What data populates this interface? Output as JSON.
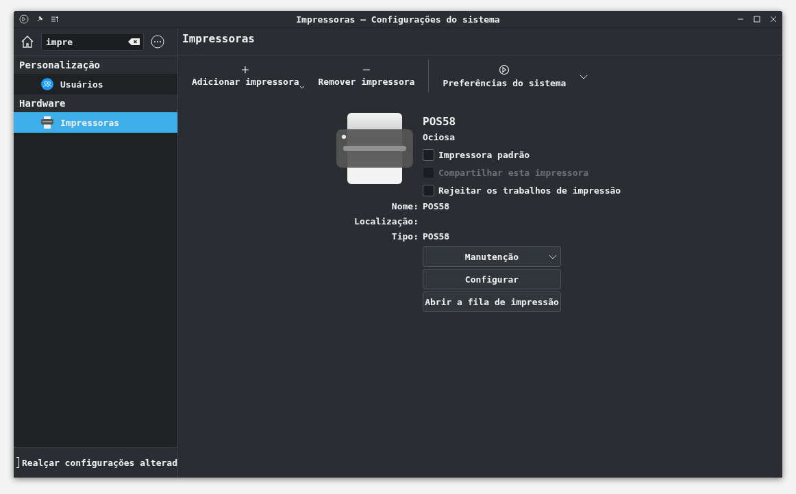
{
  "window": {
    "title": "Impressoras — Configurações do sistema"
  },
  "search": {
    "value": "impre"
  },
  "sidebar": {
    "groups": [
      {
        "label": "Personalização",
        "items": [
          {
            "label": "Usuários",
            "kind": "users",
            "selected": false
          }
        ]
      },
      {
        "label": "Hardware",
        "items": [
          {
            "label": "Impressoras",
            "kind": "printer",
            "selected": true
          }
        ]
      }
    ]
  },
  "highlight_changed": {
    "label": "Realçar configurações alterad",
    "checked": false
  },
  "page": {
    "title": "Impressoras"
  },
  "toolbar": [
    {
      "kind": "add",
      "label": "Adicionar impressora",
      "menu": true
    },
    {
      "kind": "remove",
      "label": "Remover impressora",
      "menu": false
    },
    {
      "kind": "preferences",
      "label": "Preferências do sistema",
      "menu": false
    }
  ],
  "printer": {
    "name": "POS58",
    "status": "Ociosa",
    "options": [
      {
        "label": "Impressora padrão",
        "checked": false,
        "disabled": false
      },
      {
        "label": "Compartilhar esta impressora",
        "checked": false,
        "disabled": true
      },
      {
        "label": "Rejeitar os trabalhos de impressão",
        "checked": false,
        "disabled": false
      }
    ],
    "details": [
      {
        "label": "Nome:",
        "value": "POS58"
      },
      {
        "label": "Localização:"
      },
      {
        "label": "Tipo:",
        "value": "POS58"
      }
    ],
    "buttons": [
      {
        "kind": "dropdown",
        "label": "Manutenção"
      },
      {
        "kind": "button",
        "label": "Configurar"
      },
      {
        "kind": "button",
        "label": "Abrir a fila de impressão"
      }
    ]
  }
}
